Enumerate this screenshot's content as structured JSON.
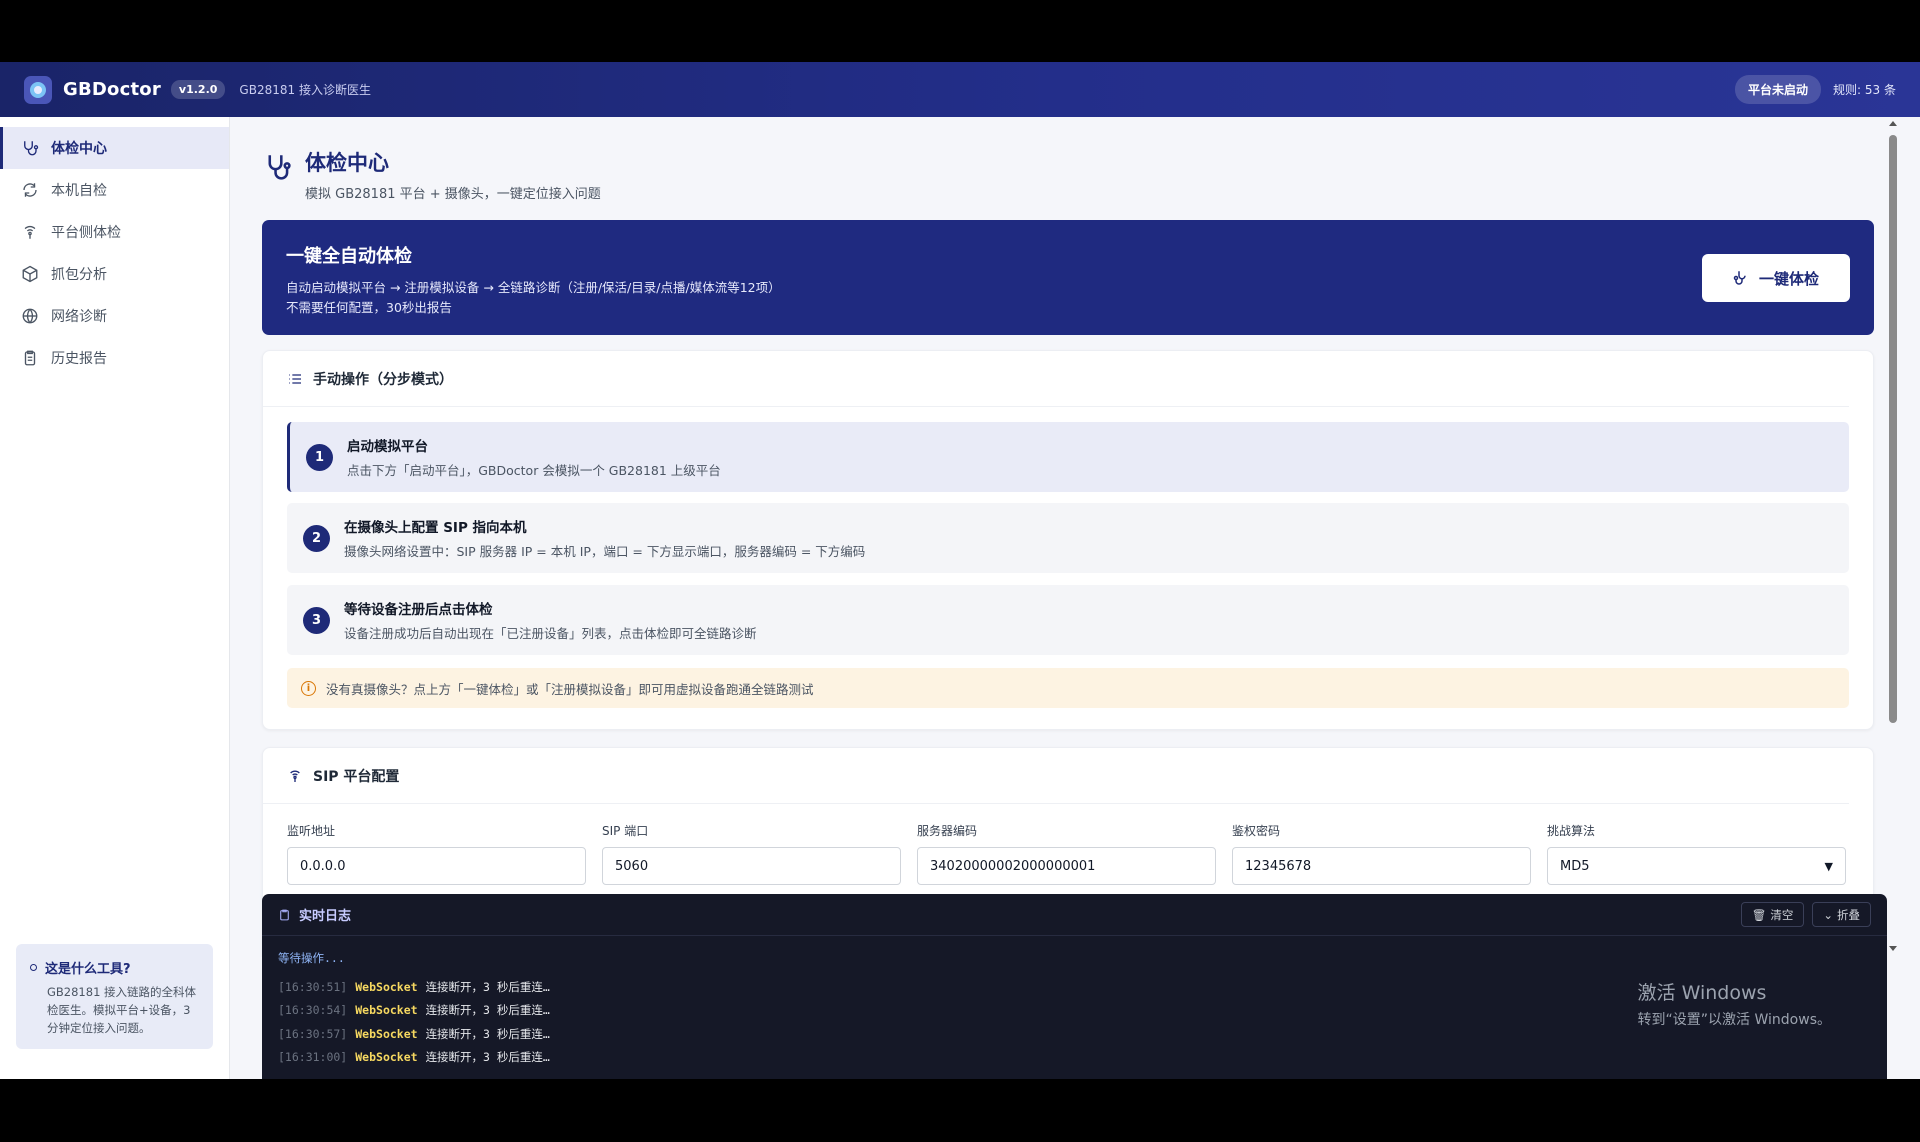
{
  "header": {
    "brand": "GBDoctor",
    "version": "v1.2.0",
    "subtitle": "GB28181 接入诊断医生",
    "status": "平台未启动",
    "rules": "规则: 53 条"
  },
  "sidebar": {
    "items": [
      {
        "label": "体检中心",
        "icon": "stethoscope-icon",
        "active": true
      },
      {
        "label": "本机自检",
        "icon": "refresh-icon",
        "active": false
      },
      {
        "label": "平台侧体检",
        "icon": "broadcast-icon",
        "active": false
      },
      {
        "label": "抓包分析",
        "icon": "package-icon",
        "active": false
      },
      {
        "label": "网络诊断",
        "icon": "globe-icon",
        "active": false
      },
      {
        "label": "历史报告",
        "icon": "clipboard-icon",
        "active": false
      }
    ],
    "info": {
      "title": "这是什么工具?",
      "text": "GB28181 接入链路的全科体检医生。模拟平台+设备，3 分钟定位接入问题。"
    }
  },
  "page": {
    "title": "体检中心",
    "desc": "模拟 GB28181 平台 + 摄像头，一键定位接入问题"
  },
  "hero": {
    "title": "一键全自动体检",
    "line1": "自动启动模拟平台 → 注册模拟设备 → 全链路诊断（注册/保活/目录/点播/媒体流等12项）",
    "line2": "不需要任何配置，30秒出报告",
    "button": "一键体检"
  },
  "manual": {
    "title": "手动操作（分步模式）",
    "steps": [
      {
        "num": "1",
        "title": "启动模拟平台",
        "desc": "点击下方「启动平台」，GBDoctor 会模拟一个 GB28181 上级平台"
      },
      {
        "num": "2",
        "title": "在摄像头上配置 SIP 指向本机",
        "desc": "摄像头网络设置中：SIP 服务器 IP = 本机 IP，端口 = 下方显示端口，服务器编码 = 下方编码"
      },
      {
        "num": "3",
        "title": "等待设备注册后点击体检",
        "desc": "设备注册成功后自动出现在「已注册设备」列表，点击体检即可全链路诊断"
      }
    ],
    "tip": "没有真摄像头？点上方「一键体检」或「注册模拟设备」即可用虚拟设备跑通全链路测试"
  },
  "sip": {
    "title": "SIP 平台配置",
    "fields": [
      {
        "label": "监听地址",
        "value": "0.0.0.0"
      },
      {
        "label": "SIP 端口",
        "value": "5060"
      },
      {
        "label": "服务器编码",
        "value": "34020000002000000001"
      },
      {
        "label": "鉴权密码",
        "value": "12345678"
      },
      {
        "label": "挑战算法",
        "value": "MD5"
      }
    ]
  },
  "log": {
    "title": "实时日志",
    "clear": "清空",
    "collapse": "折叠",
    "waiting": "等待操作...",
    "lines": [
      {
        "time": "[16:30:51]",
        "src": "WebSocket",
        "msg": "连接断开，3 秒后重连…"
      },
      {
        "time": "[16:30:54]",
        "src": "WebSocket",
        "msg": "连接断开，3 秒后重连…"
      },
      {
        "time": "[16:30:57]",
        "src": "WebSocket",
        "msg": "连接断开，3 秒后重连…"
      },
      {
        "time": "[16:31:00]",
        "src": "WebSocket",
        "msg": "连接断开，3 秒后重连…"
      }
    ]
  },
  "watermark": {
    "line1": "激活 Windows",
    "line2": "转到“设置”以激活 Windows。"
  }
}
